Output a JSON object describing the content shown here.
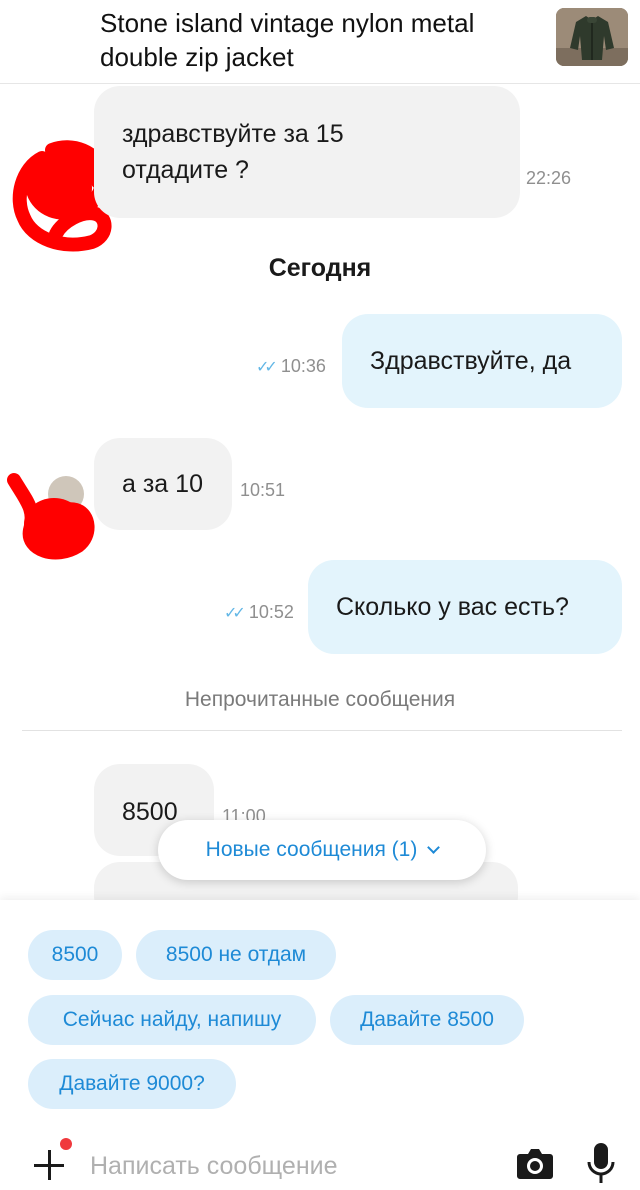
{
  "header": {
    "title": "Stone island vintage nylon metal double zip jacket",
    "thumbnail_icon": "jacket-photo"
  },
  "messages": [
    {
      "direction": "in",
      "text": "здравствуйте за 15 отдадите ?",
      "time": "22:26"
    },
    {
      "direction": "out",
      "text": "Здравствуйте, да",
      "time": "10:36",
      "read": true
    },
    {
      "direction": "in",
      "text": "а за 10",
      "time": "10:51"
    },
    {
      "direction": "out",
      "text": "Сколько у вас есть?",
      "time": "10:52",
      "read": true
    },
    {
      "direction": "in",
      "text": "8500",
      "time": "11:00"
    }
  ],
  "day_separator": "Сегодня",
  "unread_label": "Непрочитанные сообщения",
  "new_messages_button": "Новые сообщения (1)",
  "quick_replies": [
    "8500",
    "8500 не отдам",
    "Сейчас найду, напишу",
    "Давайте 8500",
    "Давайте 9000?"
  ],
  "composer": {
    "placeholder": "Написать сообщение",
    "value": ""
  },
  "colors": {
    "incoming_bubble": "#f2f2f2",
    "outgoing_bubble": "#e3f4fc",
    "accent": "#1e8ad6",
    "chip_bg": "#dbeefb",
    "read_checks": "#63b7e6",
    "notification_dot": "#f0393d",
    "scribble": "#ff0000"
  }
}
